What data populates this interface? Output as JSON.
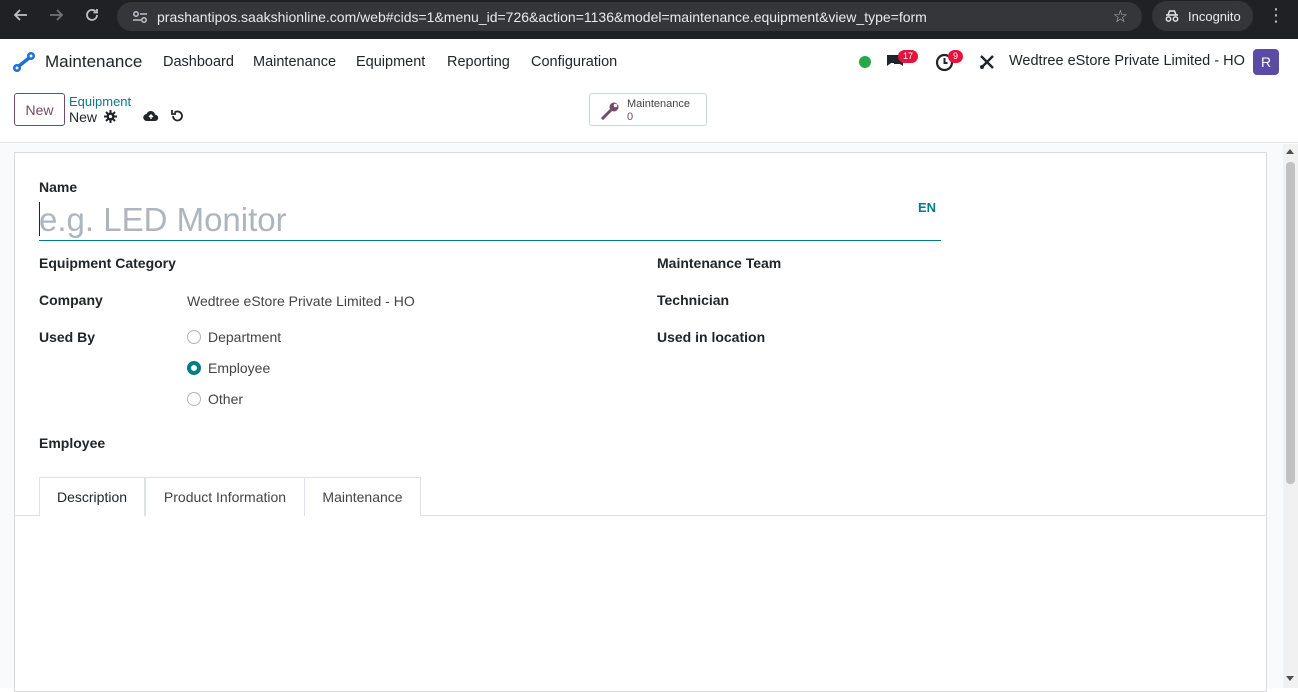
{
  "browser": {
    "url": "prashantipos.saakshionline.com/web#cids=1&menu_id=726&action=1136&model=maintenance.equipment&view_type=form",
    "incognito_label": "Incognito"
  },
  "navbar": {
    "app_name": "Maintenance",
    "menu": [
      "Dashboard",
      "Maintenance",
      "Equipment",
      "Reporting",
      "Configuration"
    ],
    "messages_count": "17",
    "activities_count": "9",
    "company": "Wedtree eStore Private Limited - HO",
    "avatar_letter": "R",
    "status_color": "#28a745"
  },
  "control": {
    "new_label": "New",
    "breadcrumb_parent": "Equipment",
    "breadcrumb_current": "New",
    "smart_button": {
      "label": "Maintenance",
      "value": "0"
    }
  },
  "form": {
    "name_label": "Name",
    "name_placeholder": "e.g. LED Monitor",
    "lang": "EN",
    "left": {
      "category_label": "Equipment Category",
      "company_label": "Company",
      "company_value": "Wedtree eStore Private Limited - HO",
      "used_by_label": "Used By",
      "used_by_options": [
        "Department",
        "Employee",
        "Other"
      ],
      "used_by_selected": "Employee",
      "employee_label": "Employee"
    },
    "right": {
      "team_label": "Maintenance Team",
      "technician_label": "Technician",
      "location_label": "Used in location"
    },
    "tabs": [
      "Description",
      "Product Information",
      "Maintenance"
    ],
    "active_tab": "Description"
  },
  "colors": {
    "primary": "#714b67",
    "teal": "#017e84",
    "badge": "#e4143d"
  }
}
